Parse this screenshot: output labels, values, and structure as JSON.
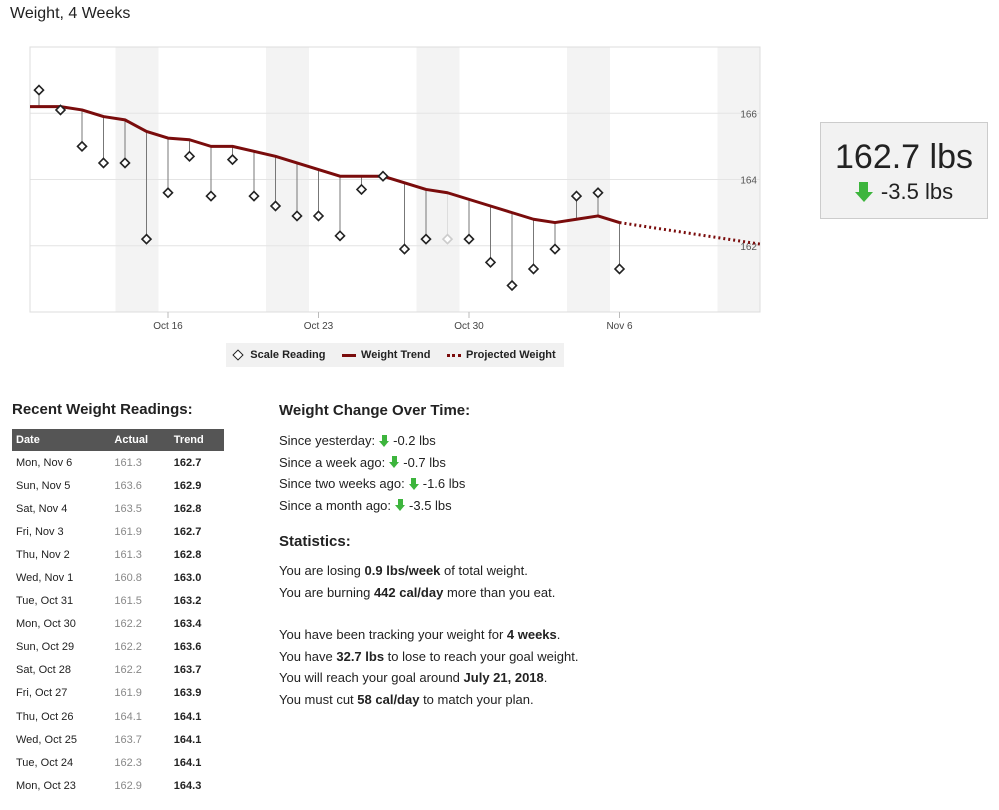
{
  "title": "Weight, 4 Weeks",
  "colors": {
    "trend": "#7a0c0c",
    "down_arrow": "#3db53d",
    "header_bg": "#555555",
    "weekend": "#f3f3f3"
  },
  "chart_data": {
    "type": "line",
    "ylim": [
      160,
      168
    ],
    "yticks": [
      "166",
      "164",
      "162"
    ],
    "xticks": [
      "Oct 16",
      "Oct 23",
      "Oct 30",
      "Nov 6"
    ],
    "grid": true,
    "legend_position": "bottom",
    "legend": [
      "Scale Reading",
      "Weight Trend",
      "Projected Weight"
    ],
    "weekends": [
      "Oct 14",
      "Oct 21",
      "Oct 28",
      "Nov 4",
      "Nov 11"
    ],
    "series": [
      {
        "name": "Scale Reading",
        "type": "scatter",
        "x": [
          "Oct 10",
          "Oct 11",
          "Oct 12",
          "Oct 13",
          "Oct 14",
          "Oct 15",
          "Oct 16",
          "Oct 17",
          "Oct 18",
          "Oct 19",
          "Oct 20",
          "Oct 21",
          "Oct 22",
          "Oct 23",
          "Oct 24",
          "Oct 25",
          "Oct 26",
          "Oct 27",
          "Oct 28",
          "Oct 29",
          "Oct 30",
          "Oct 31",
          "Nov 1",
          "Nov 2",
          "Nov 3",
          "Nov 4",
          "Nov 5",
          "Nov 6"
        ],
        "y": [
          166.7,
          166.1,
          165.0,
          164.5,
          164.5,
          162.2,
          163.6,
          164.7,
          163.5,
          164.6,
          163.5,
          163.2,
          162.9,
          162.9,
          162.3,
          163.7,
          164.1,
          161.9,
          162.2,
          162.2,
          162.2,
          161.5,
          160.8,
          161.3,
          161.9,
          163.5,
          163.6,
          161.3
        ],
        "estimated": [
          "Oct 29"
        ]
      },
      {
        "name": "Weight Trend",
        "type": "line",
        "x": [
          "Oct 9",
          "Oct 10",
          "Oct 11",
          "Oct 12",
          "Oct 13",
          "Oct 14",
          "Oct 15",
          "Oct 16",
          "Oct 17",
          "Oct 18",
          "Oct 19",
          "Oct 20",
          "Oct 21",
          "Oct 22",
          "Oct 23",
          "Oct 24",
          "Oct 25",
          "Oct 26",
          "Oct 27",
          "Oct 28",
          "Oct 29",
          "Oct 30",
          "Oct 31",
          "Nov 1",
          "Nov 2",
          "Nov 3",
          "Nov 4",
          "Nov 5",
          "Nov 6"
        ],
        "y": [
          166.2,
          166.2,
          166.2,
          166.1,
          165.9,
          165.8,
          165.45,
          165.25,
          165.2,
          165.0,
          165.0,
          164.85,
          164.7,
          164.5,
          164.3,
          164.1,
          164.1,
          164.1,
          163.9,
          163.7,
          163.6,
          163.4,
          163.2,
          163.0,
          162.8,
          162.7,
          162.8,
          162.9,
          162.7
        ]
      },
      {
        "name": "Projected Weight",
        "type": "line",
        "style": "dotted",
        "x": [
          "Nov 6",
          "Nov 12"
        ],
        "y": [
          162.7,
          162.05
        ]
      }
    ]
  },
  "summary": {
    "current": "162.7 lbs",
    "change": "-3.5 lbs"
  },
  "recent": {
    "title": "Recent Weight Readings:",
    "columns": [
      "Date",
      "Actual",
      "Trend"
    ],
    "rows": [
      [
        "Mon, Nov 6",
        "161.3",
        "162.7"
      ],
      [
        "Sun, Nov 5",
        "163.6",
        "162.9"
      ],
      [
        "Sat, Nov 4",
        "163.5",
        "162.8"
      ],
      [
        "Fri, Nov 3",
        "161.9",
        "162.7"
      ],
      [
        "Thu, Nov 2",
        "161.3",
        "162.8"
      ],
      [
        "Wed, Nov 1",
        "160.8",
        "163.0"
      ],
      [
        "Tue, Oct 31",
        "161.5",
        "163.2"
      ],
      [
        "Mon, Oct 30",
        "162.2",
        "163.4"
      ],
      [
        "Sun, Oct 29",
        "162.2",
        "163.6"
      ],
      [
        "Sat, Oct 28",
        "162.2",
        "163.7"
      ],
      [
        "Fri, Oct 27",
        "161.9",
        "163.9"
      ],
      [
        "Thu, Oct 26",
        "164.1",
        "164.1"
      ],
      [
        "Wed, Oct 25",
        "163.7",
        "164.1"
      ],
      [
        "Tue, Oct 24",
        "162.3",
        "164.1"
      ],
      [
        "Mon, Oct 23",
        "162.9",
        "164.3"
      ]
    ]
  },
  "change": {
    "title": "Weight Change Over Time:",
    "items": [
      {
        "label": "Since yesterday:",
        "value": "-0.2 lbs"
      },
      {
        "label": "Since a week ago:",
        "value": "-0.7 lbs"
      },
      {
        "label": "Since two weeks ago:",
        "value": "-1.6 lbs"
      },
      {
        "label": "Since a month ago:",
        "value": "-3.5 lbs"
      }
    ]
  },
  "stats": {
    "title": "Statistics:",
    "lines": [
      [
        "You are losing ",
        "0.9 lbs/week",
        " of total weight."
      ],
      [
        "You are burning ",
        "442 cal/day",
        " more than you eat."
      ],
      [
        "You have been tracking your weight for ",
        "4 weeks",
        "."
      ],
      [
        "You have ",
        "32.7 lbs",
        " to lose to reach your goal weight."
      ],
      [
        "You will reach your goal around ",
        "July 21, 2018",
        "."
      ],
      [
        "You must cut ",
        "58 cal/day",
        " to match your plan."
      ]
    ]
  }
}
